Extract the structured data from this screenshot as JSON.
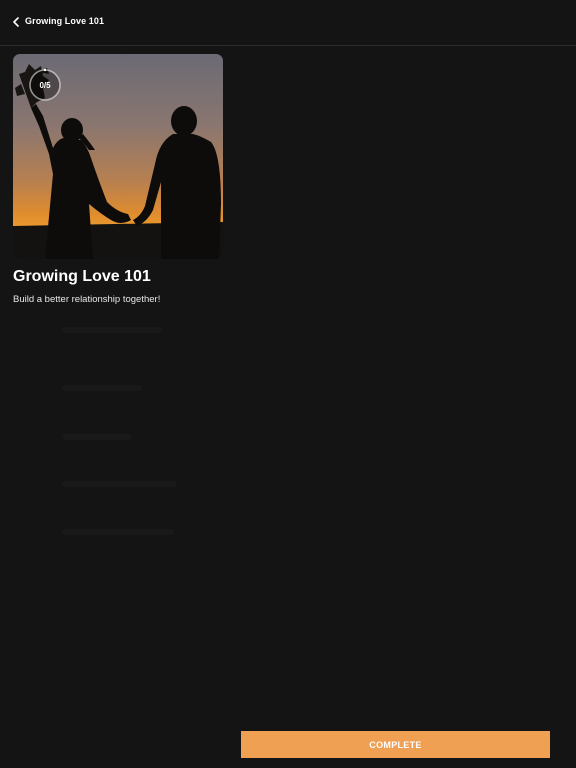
{
  "header": {
    "title": "Growing Love 101",
    "back_icon": "chevron-left-icon"
  },
  "course": {
    "title": "Growing Love 101",
    "subtitle": "Build a better relationship together!",
    "progress_text": "0/5",
    "progress_completed": 0,
    "progress_total": 5
  },
  "actions": {
    "complete_label": "COMPLETE"
  },
  "colors": {
    "background": "#141414",
    "accent": "#f0a052",
    "text": "#ffffff"
  }
}
